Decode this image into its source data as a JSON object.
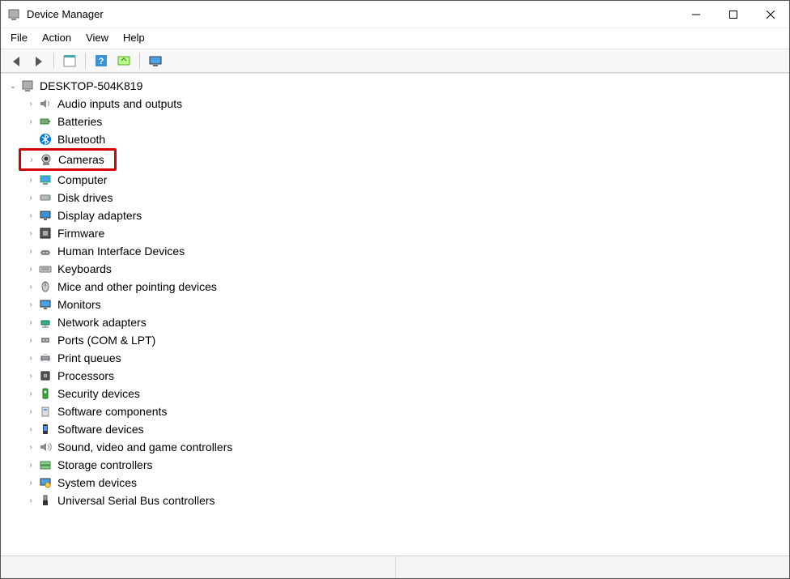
{
  "window": {
    "title": "Device Manager"
  },
  "menu": {
    "file": "File",
    "action": "Action",
    "view": "View",
    "help": "Help"
  },
  "tree": {
    "root": {
      "label": "DESKTOP-504K819",
      "expanded": true
    },
    "items": [
      {
        "label": "Audio inputs and outputs",
        "icon": "speaker-icon",
        "highlighted": false
      },
      {
        "label": "Batteries",
        "icon": "battery-icon",
        "highlighted": false
      },
      {
        "label": "Bluetooth",
        "icon": "bluetooth-icon",
        "highlighted": false,
        "noExpander": true
      },
      {
        "label": "Cameras",
        "icon": "camera-icon",
        "highlighted": true
      },
      {
        "label": "Computer",
        "icon": "computer-icon",
        "highlighted": false
      },
      {
        "label": "Disk drives",
        "icon": "disk-icon",
        "highlighted": false
      },
      {
        "label": "Display adapters",
        "icon": "display-icon",
        "highlighted": false
      },
      {
        "label": "Firmware",
        "icon": "firmware-icon",
        "highlighted": false
      },
      {
        "label": "Human Interface Devices",
        "icon": "hid-icon",
        "highlighted": false
      },
      {
        "label": "Keyboards",
        "icon": "keyboard-icon",
        "highlighted": false
      },
      {
        "label": "Mice and other pointing devices",
        "icon": "mouse-icon",
        "highlighted": false
      },
      {
        "label": "Monitors",
        "icon": "monitor-icon",
        "highlighted": false
      },
      {
        "label": "Network adapters",
        "icon": "network-icon",
        "highlighted": false
      },
      {
        "label": "Ports (COM & LPT)",
        "icon": "port-icon",
        "highlighted": false
      },
      {
        "label": "Print queues",
        "icon": "printer-icon",
        "highlighted": false
      },
      {
        "label": "Processors",
        "icon": "cpu-icon",
        "highlighted": false
      },
      {
        "label": "Security devices",
        "icon": "security-icon",
        "highlighted": false
      },
      {
        "label": "Software components",
        "icon": "software-component-icon",
        "highlighted": false
      },
      {
        "label": "Software devices",
        "icon": "software-device-icon",
        "highlighted": false
      },
      {
        "label": "Sound, video and game controllers",
        "icon": "sound-icon",
        "highlighted": false
      },
      {
        "label": "Storage controllers",
        "icon": "storage-icon",
        "highlighted": false
      },
      {
        "label": "System devices",
        "icon": "system-icon",
        "highlighted": false
      },
      {
        "label": "Universal Serial Bus controllers",
        "icon": "usb-icon",
        "highlighted": false
      }
    ]
  }
}
